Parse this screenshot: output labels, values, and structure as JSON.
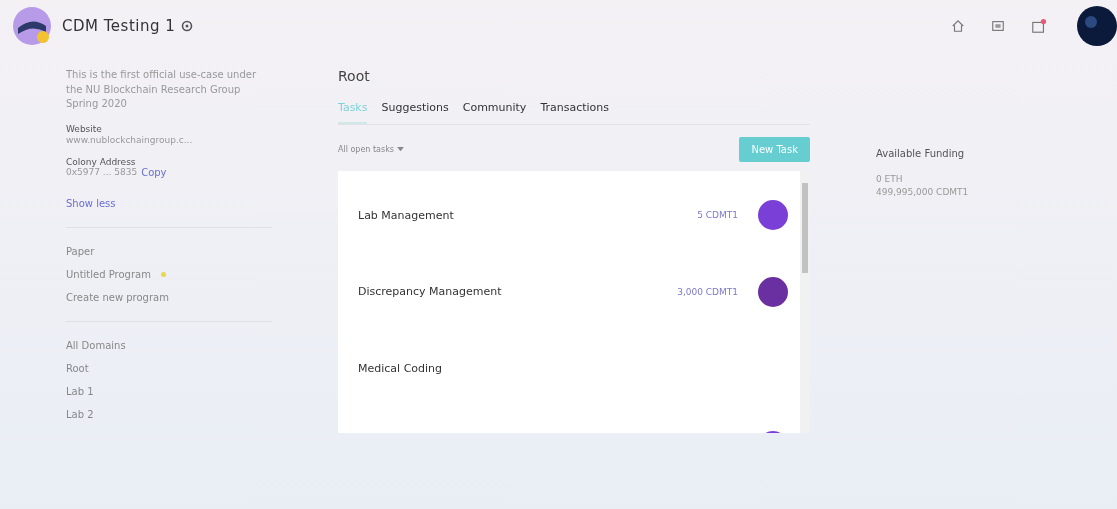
{
  "header": {
    "title": "CDM Testing 1",
    "notifications_badge": true
  },
  "colony": {
    "description": "This is the first official use-case under the NU Blockchain Research Group Spring 2020",
    "website_label": "Website",
    "website": "www.nublockchaingroup.c...",
    "address_label": "Colony Address",
    "address": "0x5977 ... 5835",
    "copy_link": "Copy",
    "toggle_link": "Show less"
  },
  "programs": {
    "heading": "Paper",
    "items": [
      {
        "label": "Untitled Program",
        "dot": true
      }
    ],
    "create_link": "Create new program"
  },
  "domains": {
    "items": [
      {
        "label": "All Domains",
        "selected": false
      },
      {
        "label": "Root",
        "selected": false
      },
      {
        "label": "Lab 1",
        "selected": false
      },
      {
        "label": "Lab 2",
        "selected": false
      }
    ]
  },
  "main": {
    "title": "Root",
    "tabs": [
      {
        "label": "Tasks",
        "selected": true
      },
      {
        "label": "Suggestions",
        "selected": false
      },
      {
        "label": "Community",
        "selected": false
      },
      {
        "label": "Transactions",
        "selected": false
      }
    ],
    "filter": "All open tasks",
    "new_button": "New Task",
    "tasks": [
      {
        "name": "Lab Management",
        "reward": "5 CDMT1",
        "color": "#7a3fd6"
      },
      {
        "name": "Discrepancy Management",
        "reward": "3,000 CDMT1",
        "color": "#6a2fa0"
      },
      {
        "name": "Medical Coding"
      },
      {
        "color": "#7a3fd6"
      }
    ]
  },
  "funding": {
    "heading": "Available Funding",
    "lines": [
      "0 ETH",
      "499,995,000 CDMT1"
    ]
  }
}
